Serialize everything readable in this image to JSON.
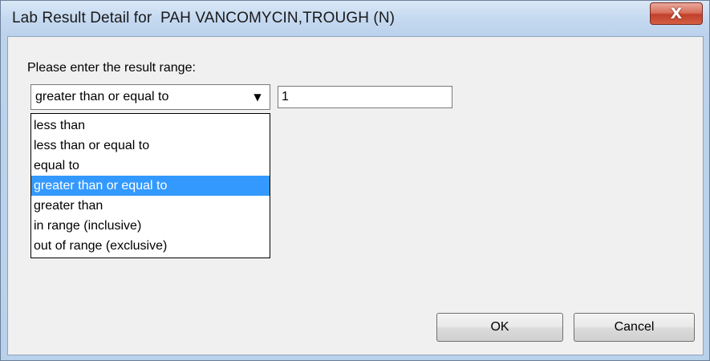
{
  "window": {
    "title": "Lab Result Detail for  PAH VANCOMYCIN,TROUGH (N)",
    "close_glyph": "X"
  },
  "form": {
    "prompt": "Please enter the result range:",
    "operator_selected": "greater than or equal to",
    "operator_options": [
      "less than",
      "less than or equal to",
      "equal to",
      "greater than or equal to",
      "greater than",
      "in range (inclusive)",
      "out of range (exclusive)"
    ],
    "highlighted_option": "greater than or equal to",
    "value": "1"
  },
  "buttons": {
    "ok_label": "OK",
    "cancel_label": "Cancel"
  },
  "icons": {
    "close": "close-icon",
    "dropdown": "chevron-down-icon"
  },
  "colors": {
    "highlight": "#3399ff",
    "close_button": "#c2402b"
  }
}
